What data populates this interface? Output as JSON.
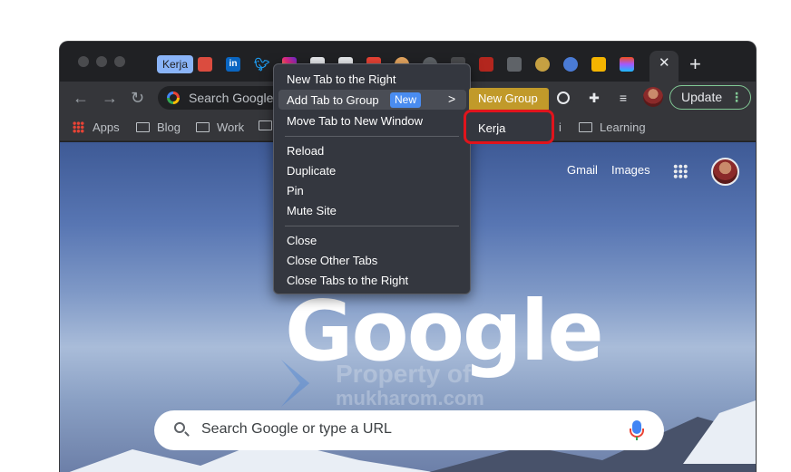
{
  "tabs": {
    "group_label": "Kerja",
    "favicons": [
      "todoist-icon",
      "linkedin-icon",
      "twitter-icon",
      "instagram-icon",
      "notion-icon",
      "notion-icon",
      "gmail-icon",
      "extension-icon",
      "timer-icon",
      "d-icon",
      "wakatime-icon",
      "bookmark-icon",
      "badge-icon",
      "nordvpn-icon",
      "classroom-icon",
      "figma-icon"
    ],
    "linkedin_text": "in",
    "close_glyph": "✕",
    "new_tab_glyph": "+"
  },
  "toolbar": {
    "back": "←",
    "forward": "→",
    "reload": "↻",
    "omnibox_text": "Search Google",
    "update_label": "Update",
    "menu_dots": "⋮"
  },
  "bookmarks": {
    "items": [
      "Apps",
      "Blog",
      "Work",
      "Learning"
    ],
    "partial": "i"
  },
  "page": {
    "gmail": "Gmail",
    "images": "Images",
    "logo": "Google",
    "watermark_line1": "Property of",
    "watermark_line2": "mukharom.com",
    "search_placeholder": "Search Google or type a URL"
  },
  "context_menu": {
    "items": [
      "New Tab to the Right",
      "Add Tab to Group",
      "Move Tab to New Window",
      "Reload",
      "Duplicate",
      "Pin",
      "Mute Site",
      "Close",
      "Close Other Tabs",
      "Close Tabs to the Right"
    ],
    "new_badge": "New",
    "arrow": ">"
  },
  "submenu": {
    "new_group": "New Group",
    "group_kerja": "Kerja"
  },
  "colors": {
    "accent_blue": "#8ab4f8",
    "highlight_red": "#e0141c",
    "new_group_gold": "#c19a2a",
    "update_green": "#81c995"
  }
}
